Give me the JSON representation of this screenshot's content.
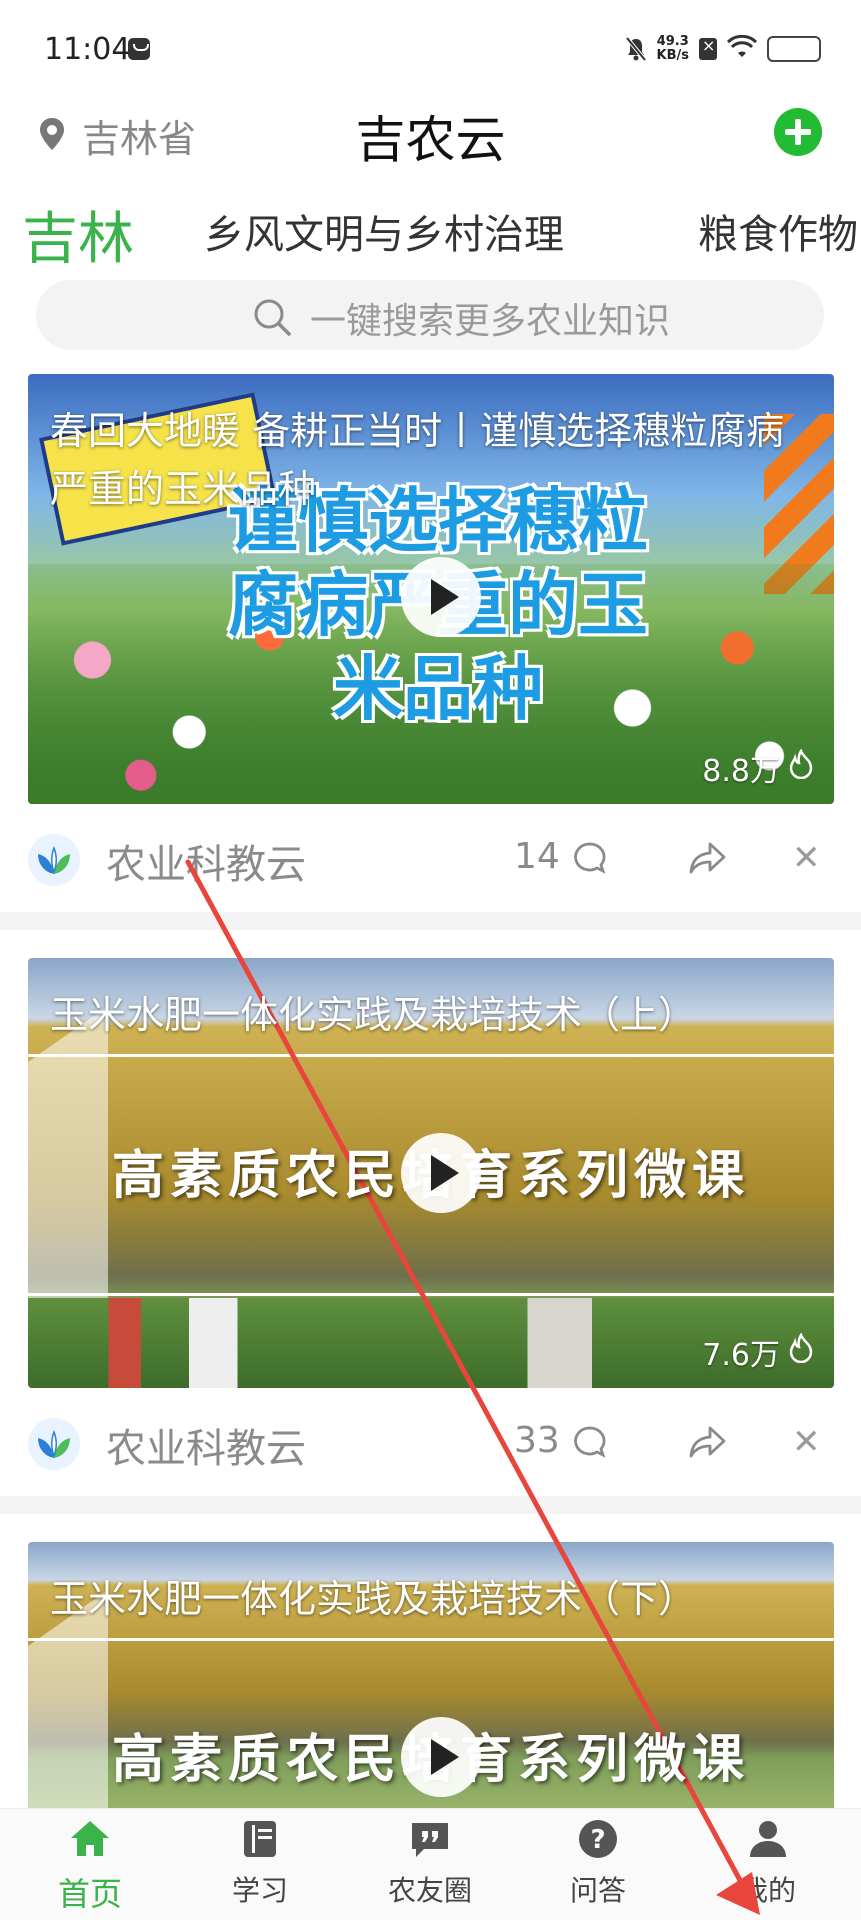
{
  "status_bar": {
    "time": "11:04",
    "net_speed_value": "49.3",
    "net_speed_unit": "KB/s"
  },
  "header": {
    "location": "吉林省",
    "title": "吉农云"
  },
  "tabs": [
    {
      "label": "吉林",
      "active": true
    },
    {
      "label": "乡风文明与乡村治理",
      "active": false
    },
    {
      "label": "粮食作物",
      "active": false
    }
  ],
  "search": {
    "placeholder": "一键搜索更多农业知识"
  },
  "feed": [
    {
      "title": "春回大地暖 备耕正当时丨谨慎选择穗粒腐病严重的玉米品种",
      "thumb_text": "谨慎选择穗粒腐病严重的玉米品种",
      "views": "8.8万",
      "author": "农业科教云",
      "comments": "14"
    },
    {
      "title": "玉米水肥一体化实践及栽培技术（上）",
      "thumb_text": "高素质农民培育系列微课",
      "views": "7.6万",
      "author": "农业科教云",
      "comments": "33"
    },
    {
      "title": "玉米水肥一体化实践及栽培技术（下）",
      "thumb_text": "高素质农民培育系列微课"
    }
  ],
  "bottom_nav": [
    {
      "label": "首页",
      "icon": "home-icon",
      "active": true
    },
    {
      "label": "学习",
      "icon": "book-icon",
      "active": false
    },
    {
      "label": "农友圈",
      "icon": "quote-chat-icon",
      "active": false
    },
    {
      "label": "问答",
      "icon": "question-icon",
      "active": false
    },
    {
      "label": "我的",
      "icon": "person-icon",
      "active": false
    }
  ],
  "colors": {
    "accent": "#3ab34a",
    "annotation_arrow": "#e8453c"
  }
}
